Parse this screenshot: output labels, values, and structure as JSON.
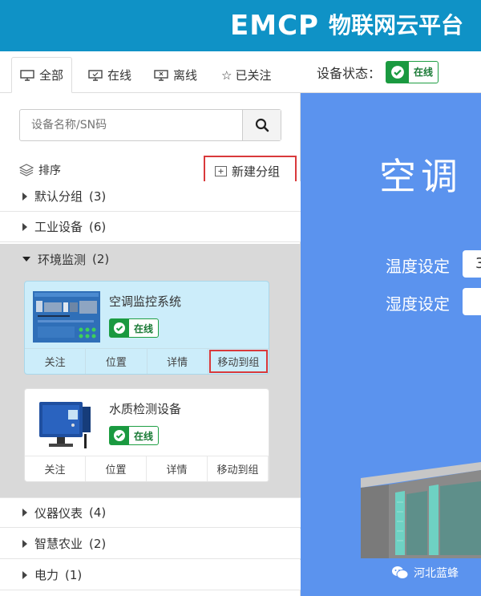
{
  "header": {
    "logo": "EMCP",
    "brand": "物联网云平台",
    "bg_color": "#0f92c6"
  },
  "tabs": [
    {
      "label": "全部",
      "icon": "monitor-icon",
      "active": true
    },
    {
      "label": "在线",
      "icon": "monitor-check-icon",
      "active": false
    },
    {
      "label": "离线",
      "icon": "monitor-x-icon",
      "active": false
    },
    {
      "label": "已关注",
      "icon": "star-icon",
      "active": false
    }
  ],
  "search": {
    "placeholder": "设备名称/SN码",
    "icon": "search-icon"
  },
  "sort": {
    "label": "排序",
    "icon": "layers-icon"
  },
  "new_group": {
    "label": "新建分组",
    "icon": "add-box-icon"
  },
  "groups": [
    {
      "name": "默认分组",
      "count": "(3)"
    },
    {
      "name": "工业设备",
      "count": "(6)"
    },
    {
      "name": "环境监测",
      "count": "(2)",
      "open": true
    },
    {
      "name": "仪器仪表",
      "count": "(4)"
    },
    {
      "name": "智慧农业",
      "count": "(2)"
    },
    {
      "name": "电力",
      "count": "(1)"
    }
  ],
  "devices": [
    {
      "name": "空调监控系统",
      "status": "在线",
      "actions": [
        "关注",
        "位置",
        "详情",
        "移动到组"
      ],
      "selected": true
    },
    {
      "name": "水质检测设备",
      "status": "在线",
      "actions": [
        "关注",
        "位置",
        "详情",
        "移动到组"
      ],
      "selected": false
    }
  ],
  "device_status": {
    "label": "设备状态：",
    "value": "在线"
  },
  "right_panel": {
    "title": "空调",
    "fields": [
      {
        "label": "温度设定",
        "value": "3"
      },
      {
        "label": "湿度设定",
        "value": ""
      }
    ],
    "bg_color": "#5b93ee"
  },
  "watermark": "河北蓝蜂",
  "colors": {
    "online_green": "#1a9940",
    "highlight_red": "#d9393b"
  }
}
